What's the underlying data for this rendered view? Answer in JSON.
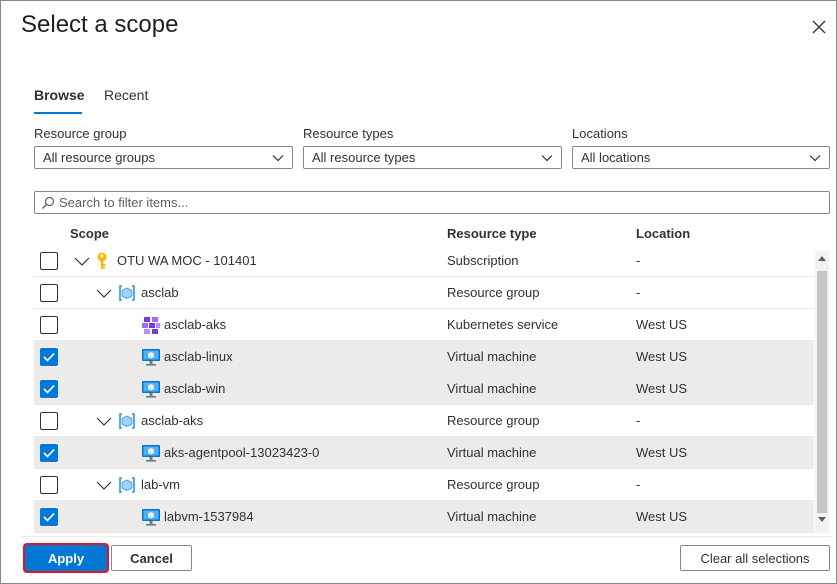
{
  "dialog": {
    "title": "Select a scope"
  },
  "tabs": [
    {
      "label": "Browse",
      "active": true
    },
    {
      "label": "Recent",
      "active": false
    }
  ],
  "filters": {
    "resource_group": {
      "label": "Resource group",
      "value": "All resource groups"
    },
    "resource_types": {
      "label": "Resource types",
      "value": "All resource types"
    },
    "locations": {
      "label": "Locations",
      "value": "All locations"
    }
  },
  "search": {
    "placeholder": "Search to filter items..."
  },
  "table": {
    "columns": [
      "Scope",
      "Resource type",
      "Location"
    ],
    "rows": [
      {
        "name": "OTU WA MOC - 101401",
        "type": "Subscription",
        "location": "-",
        "checked": false,
        "icon": "key-icon"
      },
      {
        "name": "asclab",
        "type": "Resource group",
        "location": "-",
        "checked": false,
        "icon": "resource-group-icon"
      },
      {
        "name": "asclab-aks",
        "type": "Kubernetes service",
        "location": "West US",
        "checked": false,
        "icon": "kubernetes-icon"
      },
      {
        "name": "asclab-linux",
        "type": "Virtual machine",
        "location": "West US",
        "checked": true,
        "icon": "virtual-machine-icon"
      },
      {
        "name": "asclab-win",
        "type": "Virtual machine",
        "location": "West US",
        "checked": true,
        "icon": "virtual-machine-icon"
      },
      {
        "name": "asclab-aks",
        "type": "Resource group",
        "location": "-",
        "checked": false,
        "icon": "resource-group-icon"
      },
      {
        "name": "aks-agentpool-13023423-0",
        "type": "Virtual machine",
        "location": "West US",
        "checked": true,
        "icon": "virtual-machine-icon"
      },
      {
        "name": "lab-vm",
        "type": "Resource group",
        "location": "-",
        "checked": false,
        "icon": "resource-group-icon"
      },
      {
        "name": "labvm-1537984",
        "type": "Virtual machine",
        "location": "West US",
        "checked": true,
        "icon": "virtual-machine-icon"
      }
    ]
  },
  "footer": {
    "apply": "Apply",
    "cancel": "Cancel",
    "clear": "Clear all selections"
  },
  "colors": {
    "accent": "#0078d4",
    "apply_highlight": "#e81123",
    "selected_row": "#edebe9"
  }
}
